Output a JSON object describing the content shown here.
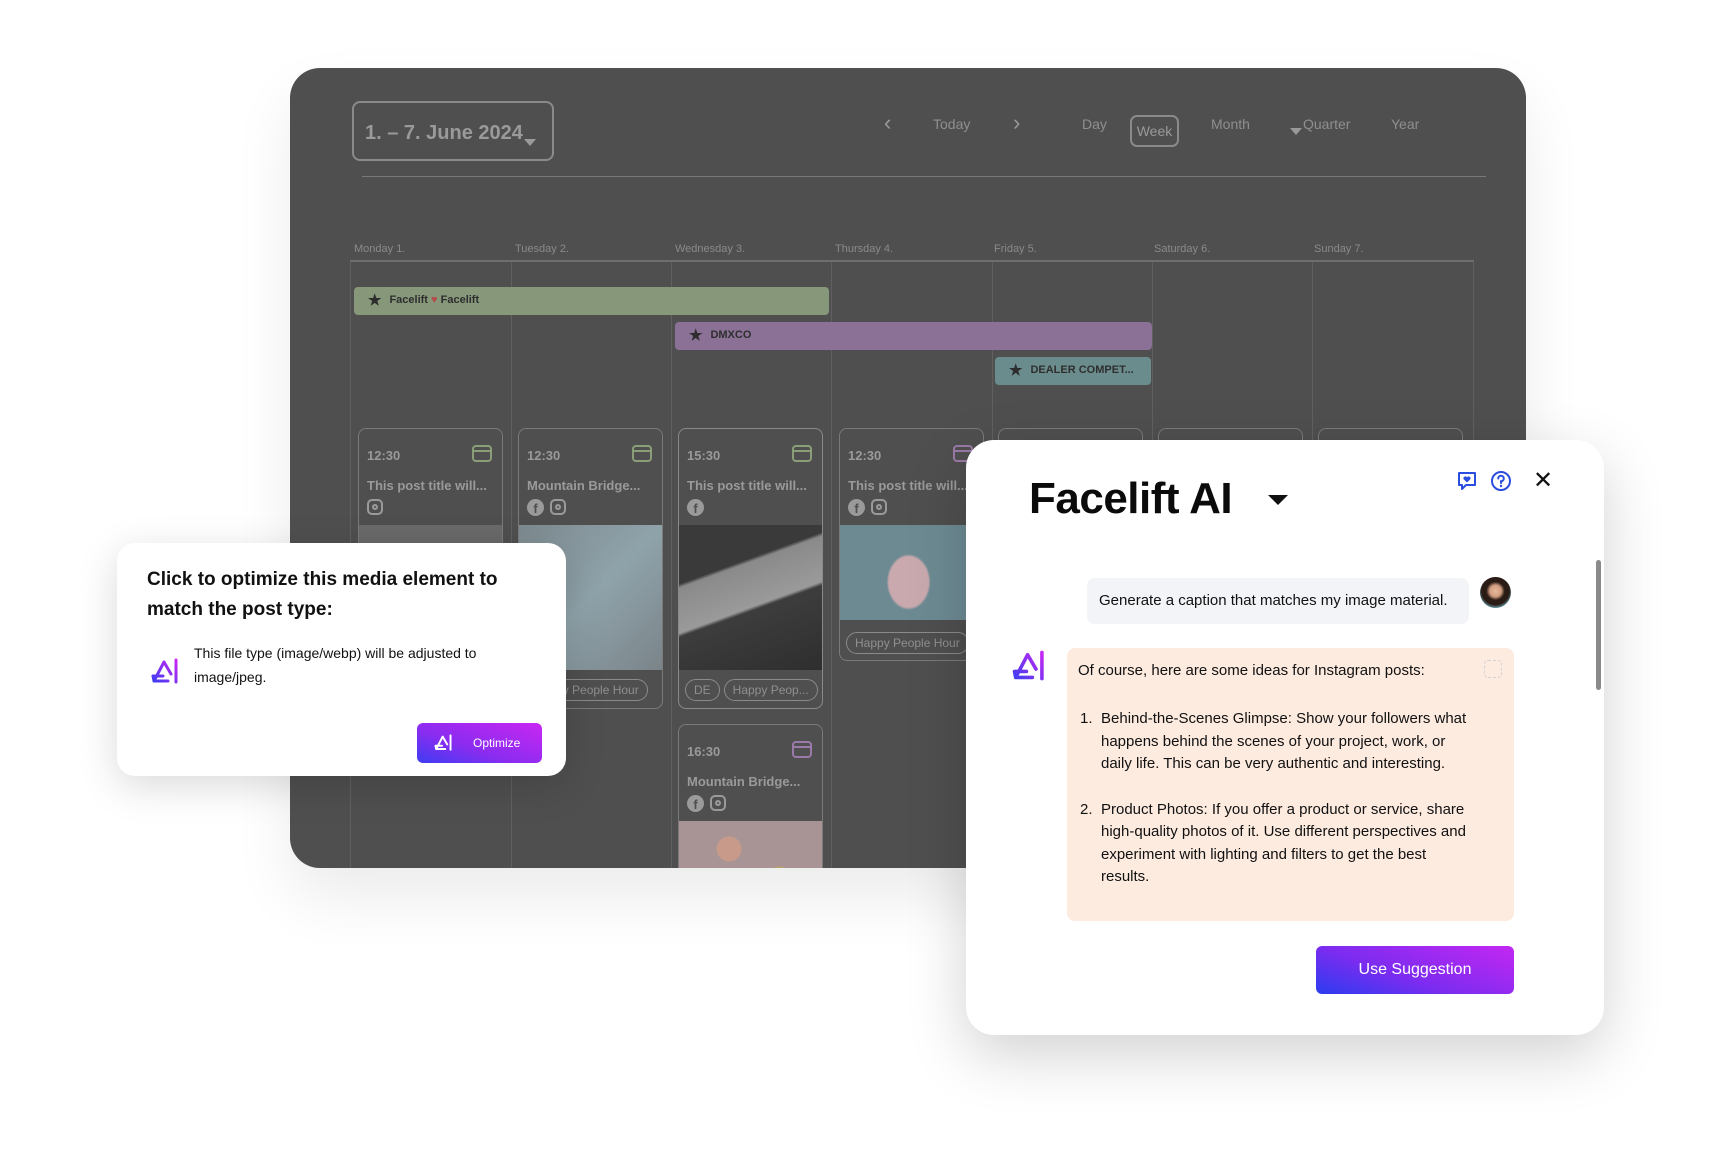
{
  "calendar": {
    "date_range": "1. – 7. June 2024",
    "nav": {
      "prev": "‹",
      "today": "Today",
      "next": "›"
    },
    "views": {
      "day": "Day",
      "week": "Week",
      "month": "Month",
      "quarter": "Quarter",
      "year": "Year"
    },
    "active_view": "Week",
    "days": [
      "Monday 1.",
      "Tuesday 2.",
      "Wednesday 3.",
      "Thursday 4.",
      "Friday 5.",
      "Saturday 6.",
      "Sunday 7."
    ],
    "events": [
      {
        "label_a": "Facelift",
        "label_b": "Facelift",
        "heart": "♥",
        "color": "#87977a"
      },
      {
        "label": "DMXCO",
        "color": "#8b7196"
      },
      {
        "label": "DEALER COMPET...",
        "color": "#6b8c8c"
      }
    ],
    "star": "★",
    "posts": [
      {
        "time": "12:30",
        "title": "This post title will...",
        "chips": []
      },
      {
        "time": "12:30",
        "title": "Mountain Bridge...",
        "chips": [
          "Happy People Hour"
        ]
      },
      {
        "time": "15:30",
        "title": "This post title will...",
        "chips": [
          "DE",
          "Happy Peop..."
        ]
      },
      {
        "time": "12:30",
        "title": "This post title will...",
        "chips": [
          "Happy People Hour"
        ]
      },
      {
        "time": "16:30",
        "title": "Mountain Bridge...",
        "chips": []
      }
    ],
    "fb": "f"
  },
  "optimize_popup": {
    "heading": "Click to optimize this media element to match the post type:",
    "description": "This file type (image/webp) will be adjusted to image/jpeg.",
    "button": "Optimize"
  },
  "ai_panel": {
    "title": "Facelift AI",
    "close": "✕",
    "user_message": "Generate a caption that matches my image material.",
    "reply_intro": "Of course, here are some ideas for Instagram posts:",
    "suggestions": [
      {
        "num": "1.",
        "text": "Behind-the-Scenes Glimpse: Show your followers what happens behind the scenes of your project, work, or daily life. This can be very authentic and interesting."
      },
      {
        "num": "2.",
        "text": "Product Photos: If you offer a product or service, share high-quality photos of it. Use different perspectives and experiment with lighting and filters to get the best results."
      }
    ],
    "use_button": "Use Suggestion",
    "colors": {
      "accent_blue": "#2a3cf0",
      "accent_purple": "#c427f2",
      "reply_bg": "#fdebe0"
    }
  }
}
